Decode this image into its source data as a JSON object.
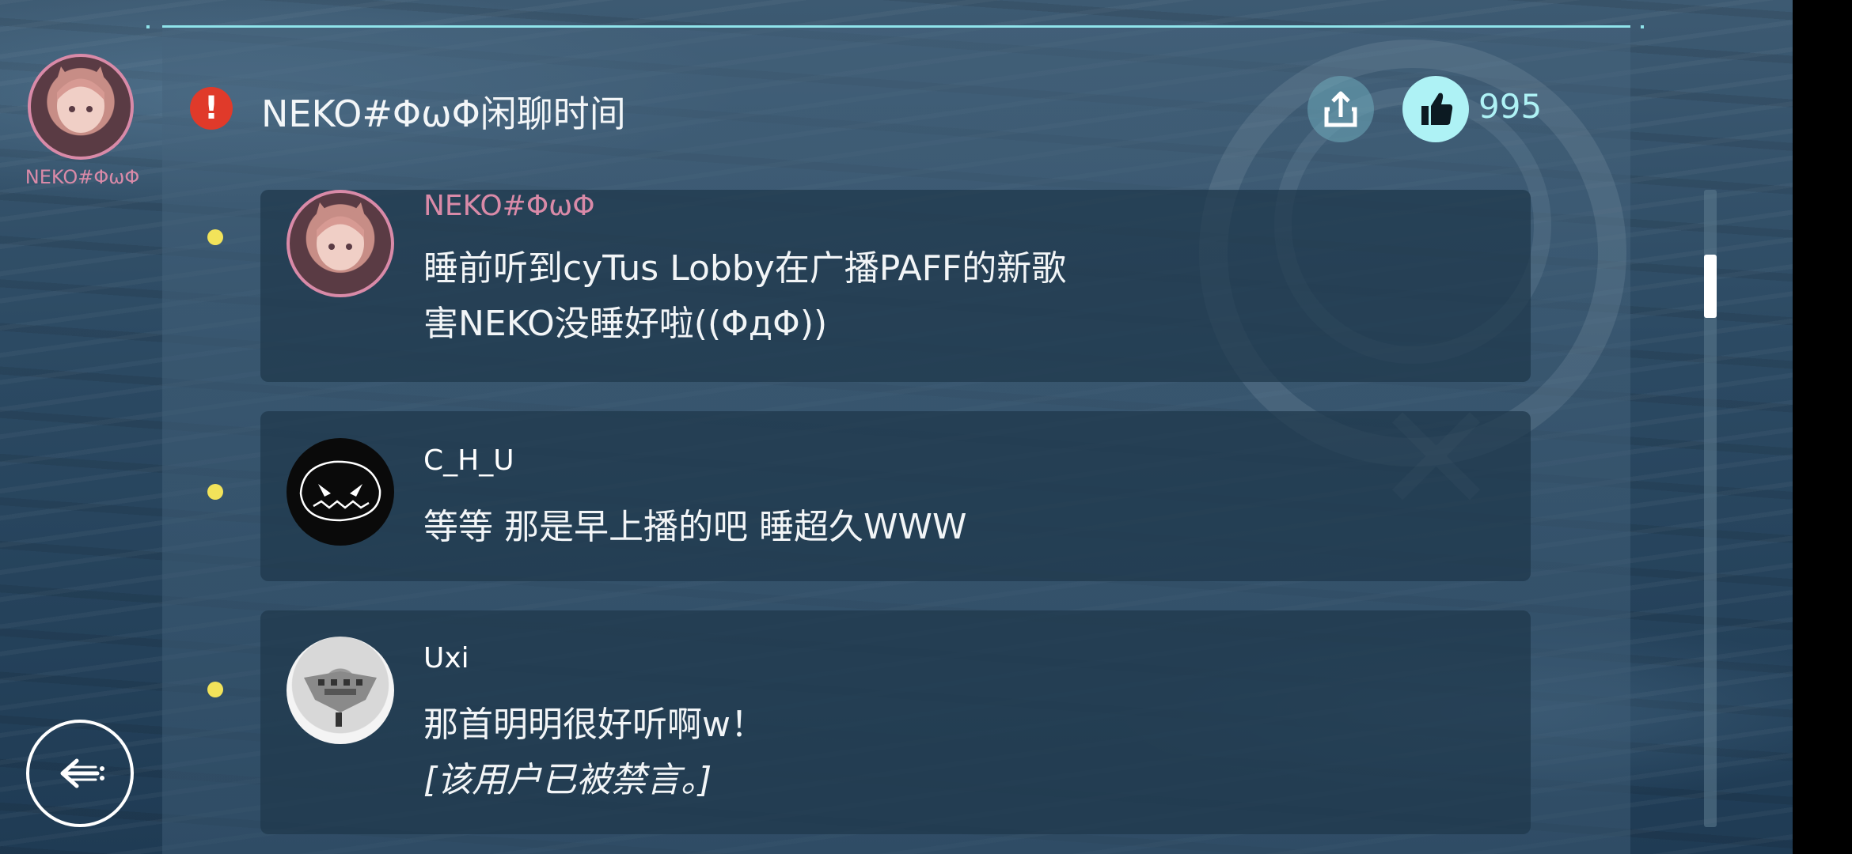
{
  "sidebar": {
    "avatar_user": "NEKO#ΦωΦ"
  },
  "header": {
    "alert_symbol": "!",
    "title": "NEKO#ΦωΦ闲聊时间",
    "like_count": "995",
    "share_icon": "share-icon",
    "like_icon": "thumbs-up-icon"
  },
  "messages": [
    {
      "user": "NEKO#ΦωΦ",
      "user_color": "#d98aa8",
      "lines": [
        "睡前听到cyTus Lobby在广播PAFF的新歌",
        "害NEKO没睡好啦((ΦдΦ))"
      ]
    },
    {
      "user": "C_H_U",
      "user_color": "#ffffff",
      "lines": [
        "等等 那是早上播的吧 睡超久WWW"
      ]
    },
    {
      "user": "Uxi",
      "user_color": "#ffffff",
      "lines": [
        "那首明明很好听啊w！"
      ],
      "note": "[该用户已被禁言。]"
    }
  ],
  "colors": {
    "accent_cyan": "#aef2f5",
    "alert_red": "#e03a2a",
    "bullet_yellow": "#f2e35a",
    "neko_pink": "#d98aa8"
  },
  "back_icon": "back-arrow-icon"
}
